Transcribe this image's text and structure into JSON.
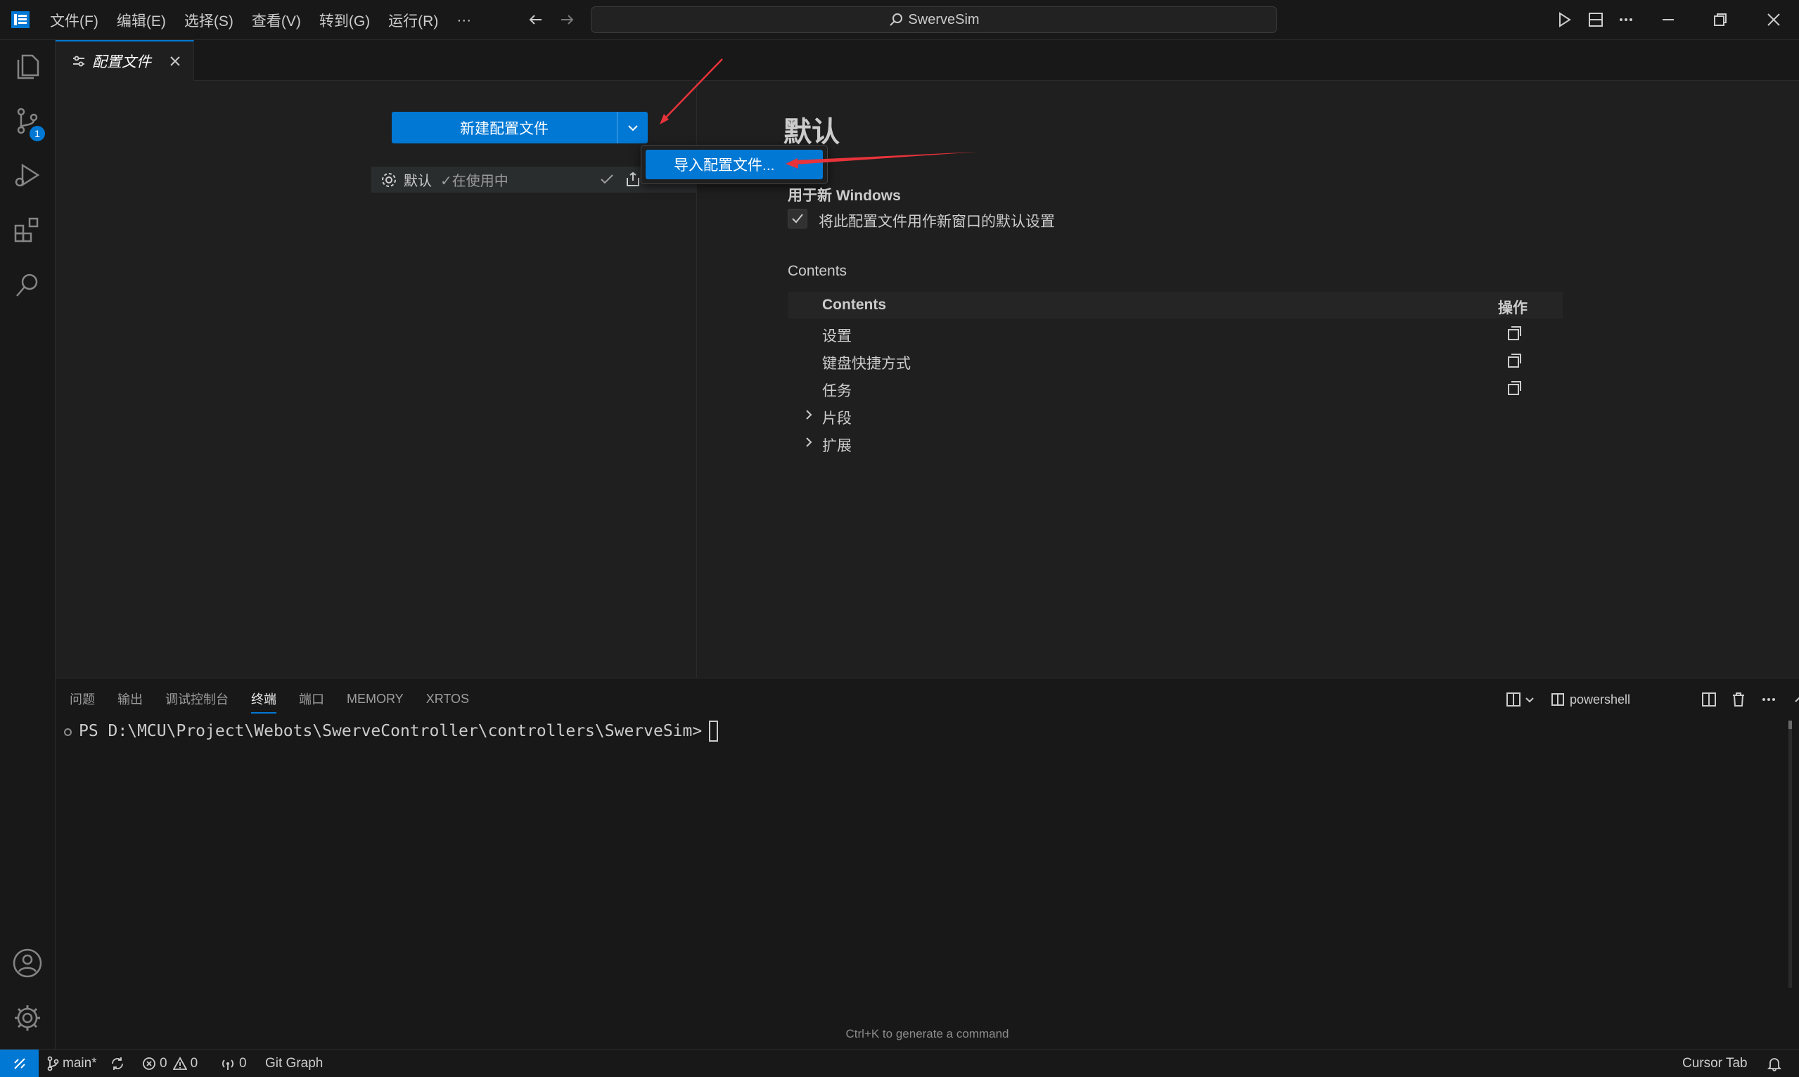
{
  "titlebar": {
    "menus": [
      "文件(F)",
      "编辑(E)",
      "选择(S)",
      "查看(V)",
      "转到(G)",
      "运行(R)",
      "···"
    ],
    "search_text": "SwerveSim"
  },
  "activitybar": {
    "items": [
      "explorer-icon",
      "source-control-icon",
      "run-debug-icon",
      "extensions-icon",
      "search-icon"
    ],
    "source_control_badge": "1",
    "bottom_items": [
      "account-icon",
      "settings-gear-icon"
    ]
  },
  "editor": {
    "tab_label": "配置文件",
    "new_profile_button": "新建配置文件",
    "import_menu_item": "导入配置文件...",
    "profile_list": [
      {
        "name": "默认",
        "status": "在使用中"
      }
    ],
    "detail": {
      "title": "默认",
      "use_for_new_windows_label": "用于新 Windows",
      "use_for_new_windows_checkbox": "将此配置文件用作新窗口的默认设置",
      "use_for_new_windows_checked": true,
      "contents_heading": "Contents",
      "table": {
        "col_contents": "Contents",
        "col_actions": "操作",
        "rows": [
          {
            "label": "设置",
            "expandable": false,
            "has_action": true
          },
          {
            "label": "键盘快捷方式",
            "expandable": false,
            "has_action": true
          },
          {
            "label": "任务",
            "expandable": false,
            "has_action": true
          },
          {
            "label": "片段",
            "expandable": true,
            "has_action": false
          },
          {
            "label": "扩展",
            "expandable": true,
            "has_action": false
          }
        ]
      }
    }
  },
  "panel": {
    "tabs": [
      "问题",
      "输出",
      "调试控制台",
      "终端",
      "端口",
      "MEMORY",
      "XRTOS"
    ],
    "active_tab": "终端",
    "terminal_name": "powershell",
    "prompt": "PS D:\\MCU\\Project\\Webots\\SwerveController\\controllers\\SwerveSim>",
    "hint": "Ctrl+K to generate a command"
  },
  "statusbar": {
    "branch": "main*",
    "errors": "0",
    "warnings": "0",
    "ports": "0",
    "git_graph": "Git Graph",
    "cursor_tab": "Cursor Tab"
  },
  "colors": {
    "accent": "#0078d4",
    "background": "#181818",
    "editor_background": "#1f1f1f",
    "annotation_arrow": "#e8333a"
  }
}
